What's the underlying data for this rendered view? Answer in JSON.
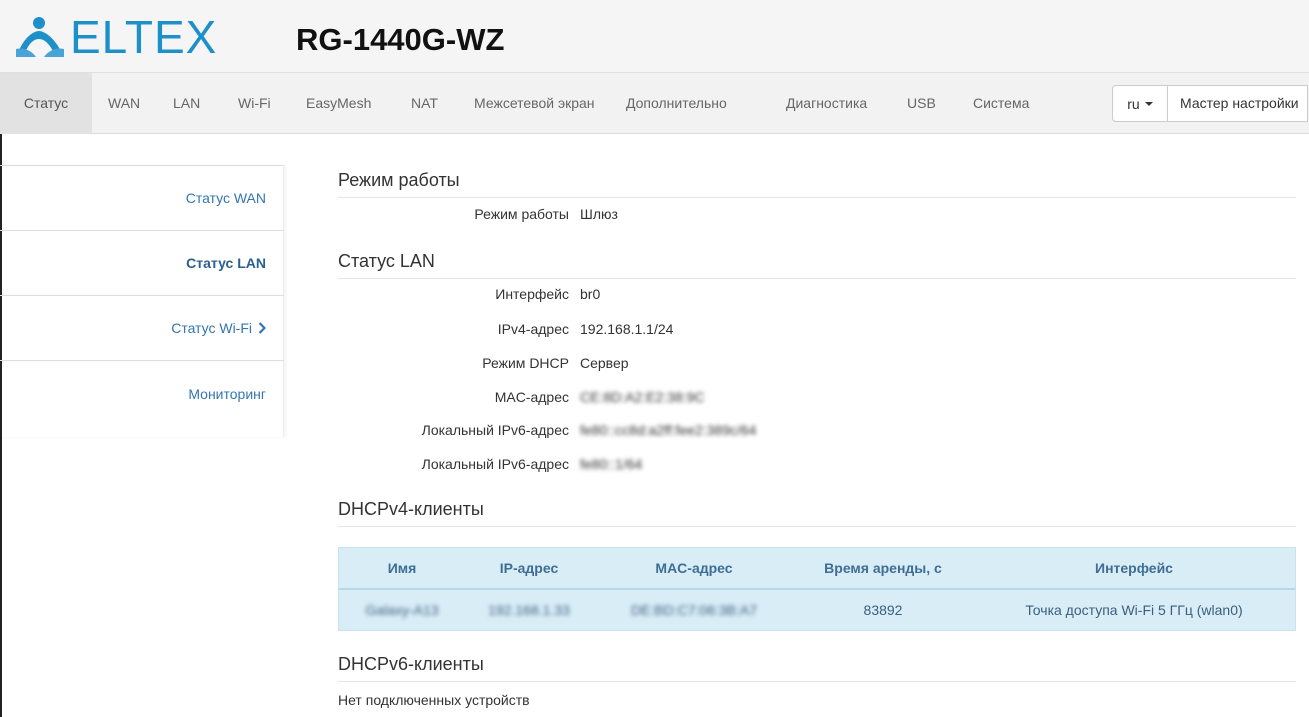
{
  "header": {
    "logo_text": "ELTEX",
    "model": "RG-1440G-WZ"
  },
  "nav": {
    "items": [
      "Статус",
      "WAN",
      "LAN",
      "Wi-Fi",
      "EasyMesh",
      "NAT",
      "Межсетевой экран",
      "Дополнительно",
      "Диагностика",
      "USB",
      "Система"
    ],
    "active": "Статус",
    "lang": "ru",
    "wizard": "Мастер настройки"
  },
  "sidebar": {
    "items": [
      {
        "label": "Статус WAN"
      },
      {
        "label": "Статус LAN"
      },
      {
        "label": "Статус Wi-Fi"
      },
      {
        "label": "Мониторинг"
      }
    ],
    "active": "Статус LAN"
  },
  "mode": {
    "title": "Режим работы",
    "rows": [
      {
        "label": "Режим работы",
        "value": "Шлюз"
      }
    ]
  },
  "lan": {
    "title": "Статус LAN",
    "rows": [
      {
        "label": "Интерфейс",
        "value": "br0"
      },
      {
        "label": "IPv4-адрес",
        "value": "192.168.1.1/24"
      },
      {
        "label": "Режим DHCP",
        "value": "Сервер"
      },
      {
        "label": "MAC-адрес",
        "value": "CE:8D:A2:E2:38:9C"
      },
      {
        "label": "Локальный IPv6-адрес",
        "value": "fe80::cc8d:a2ff:fee2:389c/64"
      },
      {
        "label": "Локальный IPv6-адрес",
        "value": "fe80::1/64"
      }
    ]
  },
  "dhcpv4": {
    "title": "DHCPv4-клиенты",
    "columns": [
      "Имя",
      "IP-адрес",
      "MAC-адрес",
      "Время аренды, с",
      "Интерфейс"
    ],
    "rows": [
      [
        "Galaxy-A13",
        "192.168.1.33",
        "DE:BD:C7:06:3B:A7",
        "83892",
        "Точка доступа Wi-Fi 5 ГГц (wlan0)"
      ]
    ]
  },
  "dhcpv6": {
    "title": "DHCPv6-клиенты",
    "empty": "Нет подключенных устройств"
  },
  "colors": {
    "brand": "#1d8fc9",
    "link": "#3275b3",
    "table_bg": "#d9edf7"
  }
}
